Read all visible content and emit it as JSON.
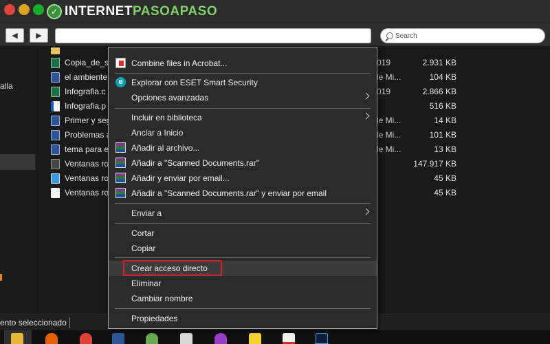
{
  "topbar": {
    "logo_main": "INTERNET",
    "logo_accent": "PASOAPASO",
    "search_placeholder": "Search"
  },
  "sidebar": {
    "partial_text": "alla"
  },
  "files": [
    {
      "name": "Copia_de_se",
      "date": "019",
      "size": "2.931 KB",
      "icon": "excel-icon"
    },
    {
      "name": "el ambiente",
      "date": "le Mi...",
      "size": "104 KB",
      "icon": "word-icon"
    },
    {
      "name": "Infografia.c",
      "date": "019",
      "size": "2.866 KB",
      "icon": "excel-icon"
    },
    {
      "name": "Infografia.p",
      "date": "",
      "size": "516 KB",
      "icon": "pdf-icon"
    },
    {
      "name": "Primer y seg",
      "date": "le Mi...",
      "size": "14 KB",
      "icon": "word-icon"
    },
    {
      "name": "Problemas a",
      "date": "le Mi...",
      "size": "101 KB",
      "icon": "word-icon"
    },
    {
      "name": "tema para e",
      "date": "le Mi...",
      "size": "13 KB",
      "icon": "word-icon"
    },
    {
      "name": "Ventanas ro",
      "date": "",
      "size": "147.917 KB",
      "icon": "video-icon"
    },
    {
      "name": "Ventanas ro",
      "date": "",
      "size": "45 KB",
      "icon": "image-icon"
    },
    {
      "name": "Ventanas ro",
      "date": "",
      "size": "45 KB",
      "icon": "file-icon"
    }
  ],
  "status": {
    "text": "ento seleccionado"
  },
  "context_menu": {
    "items": [
      {
        "label": "Combine files in Acrobat...",
        "icon": "acrobat-icon",
        "submenu": false
      },
      {
        "label": "Explorar con ESET Smart Security",
        "icon": "eset-icon",
        "submenu": false
      },
      {
        "label": "Opciones avanzadas",
        "icon": "",
        "submenu": true
      },
      {
        "label": "Incluir en biblioteca",
        "icon": "",
        "submenu": true
      },
      {
        "label": "Anclar a Inicio",
        "icon": "",
        "submenu": false
      },
      {
        "label": "Añadir al archivo...",
        "icon": "winrar-icon",
        "submenu": false
      },
      {
        "label": "Añadir a \"Scanned Documents.rar\"",
        "icon": "winrar-icon",
        "submenu": false
      },
      {
        "label": "Añadir y enviar por email...",
        "icon": "winrar-icon",
        "submenu": false
      },
      {
        "label": "Añadir a \"Scanned Documents.rar\" y enviar por email",
        "icon": "winrar-icon",
        "submenu": false
      },
      {
        "label": "Enviar a",
        "icon": "",
        "submenu": true
      },
      {
        "label": "Cortar",
        "icon": "",
        "submenu": false
      },
      {
        "label": "Copiar",
        "icon": "",
        "submenu": false
      },
      {
        "label": "Crear acceso directo",
        "icon": "",
        "submenu": false,
        "highlighted": true
      },
      {
        "label": "Eliminar",
        "icon": "",
        "submenu": false
      },
      {
        "label": "Cambiar nombre",
        "icon": "",
        "submenu": false
      },
      {
        "label": "Propiedades",
        "icon": "",
        "submenu": false
      }
    ]
  },
  "colors": {
    "highlight_border": "#d32424",
    "menu_bg": "#2b2b2b",
    "logo_accent": "#7fd36a"
  }
}
